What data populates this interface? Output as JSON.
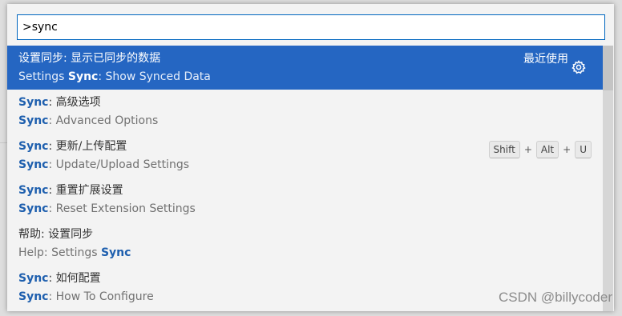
{
  "search": {
    "value": ">sync"
  },
  "items": [
    {
      "title": "设置同步: 显示已同步的数据",
      "sub_pre": "Settings ",
      "sub_hl": "Sync",
      "sub_post": ": Show Synced Data",
      "recent": "最近使用"
    },
    {
      "title_hl": "Sync",
      "title_rest": ": 高级选项",
      "sub_hl": "Sync",
      "sub_post": ": Advanced Options"
    },
    {
      "title_hl": "Sync",
      "title_rest": ": 更新/上传配置",
      "sub_hl": "Sync",
      "sub_post": ": Update/Upload Settings",
      "keys": [
        "Shift",
        "Alt",
        "U"
      ],
      "key_sep": "+"
    },
    {
      "title_hl": "Sync",
      "title_rest": ": 重置扩展设置",
      "sub_hl": "Sync",
      "sub_post": ": Reset Extension Settings"
    },
    {
      "title": "帮助: 设置同步",
      "sub_pre": "Help: Settings ",
      "sub_hl": "Sync"
    },
    {
      "title_hl": "Sync",
      "title_rest": ": 如何配置",
      "sub_hl": "Sync",
      "sub_post": ": How To Configure"
    }
  ],
  "watermark": "CSDN @billycoder",
  "colors": {
    "selection": "#2566c2",
    "highlight": "#1e5fae",
    "input_border": "#0066bf"
  },
  "icons": {
    "gear": "gear-icon"
  }
}
